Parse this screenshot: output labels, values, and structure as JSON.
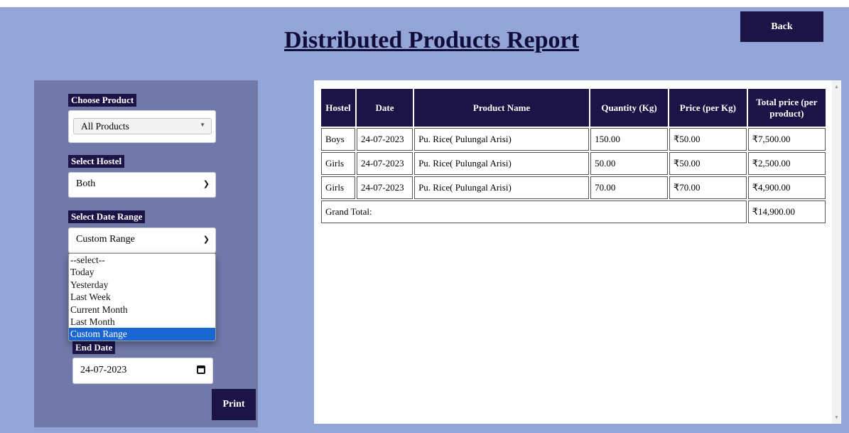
{
  "page": {
    "title": "Distributed Products Report",
    "back_label": "Back"
  },
  "filters": {
    "product_label": "Choose Product",
    "product_value": "All Products",
    "hostel_label": "Select Hostel",
    "hostel_value": "Both",
    "date_range_label": "Select Date Range",
    "date_range_value": "Custom Range",
    "date_range_options": [
      "--select--",
      "Today",
      "Yesterday",
      "Last Week",
      "Current Month",
      "Last Month",
      "Custom Range"
    ],
    "end_date_label": "End Date",
    "end_date_value": "24-07-2023",
    "print_label": "Print"
  },
  "table": {
    "columns": [
      "Hostel",
      "Date",
      "Product Name",
      "Quantity (Kg)",
      "Price (per Kg)",
      "Total price (per product)"
    ],
    "rows": [
      [
        "Boys",
        "24-07-2023",
        "Pu. Rice( Pulungal Arisi)",
        "150.00",
        "₹50.00",
        "₹7,500.00"
      ],
      [
        "Girls",
        "24-07-2023",
        "Pu. Rice( Pulungal Arisi)",
        "50.00",
        "₹50.00",
        "₹2,500.00"
      ],
      [
        "Girls",
        "24-07-2023",
        "Pu. Rice( Pulungal Arisi)",
        "70.00",
        "₹70.00",
        "₹4,900.00"
      ]
    ],
    "grand_total_label": "Grand Total:",
    "grand_total_value": "₹14,900.00"
  },
  "colors": {
    "background": "#93a5d6",
    "panel": "#7079a8",
    "accent": "#1c1347",
    "selected_option": "#1a66d2"
  },
  "icons": {
    "calendar": "calendar-icon",
    "dropdown": "chevron-down-icon"
  }
}
